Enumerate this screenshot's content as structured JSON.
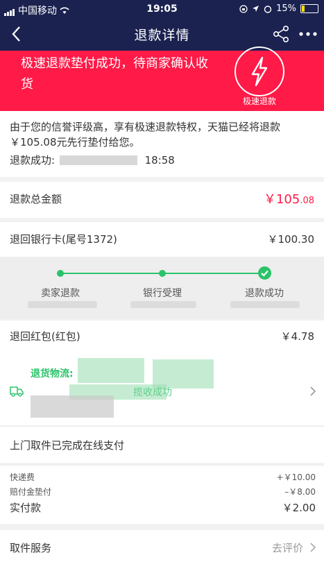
{
  "status_bar": {
    "carrier": "中国移动",
    "time": "19:05",
    "battery": "15%"
  },
  "nav": {
    "title": "退款详情"
  },
  "banner": {
    "message": "极速退款垫付成功，待商家确认收货",
    "badge_label": "极速退款"
  },
  "info": {
    "text": "由于您的信誉评级高，享有极速退款特权，天猫已经将退款￥105.08元先行垫付给您。",
    "success_label": "退款成功:",
    "success_time": "18:58"
  },
  "total": {
    "label": "退款总金额",
    "amount_main": "￥105",
    "amount_decimal": ".08"
  },
  "bank": {
    "label": "退回银行卡(尾号1372)",
    "amount": "￥100.30"
  },
  "progress": {
    "steps": [
      "卖家退款",
      "银行受理",
      "退款成功"
    ]
  },
  "redpacket": {
    "label": "退回红包(红包)",
    "amount": "￥4.78"
  },
  "logistics": {
    "title": "退货物流:",
    "status": "揽收成功"
  },
  "pickup": {
    "label": "上门取件已完成在线支付"
  },
  "fees": {
    "items": [
      {
        "label": "快递费",
        "value": "+￥10.00"
      },
      {
        "label": "赔付金垫付",
        "value": "–￥8.00"
      }
    ],
    "total_label": "实付款",
    "total_value": "￥2.00"
  },
  "service": {
    "label": "取件服务",
    "action": "去评价"
  },
  "colors": {
    "nav_bg": "#1b2250",
    "banner_red": "#ff1a48",
    "success_green": "#2bc36a"
  }
}
